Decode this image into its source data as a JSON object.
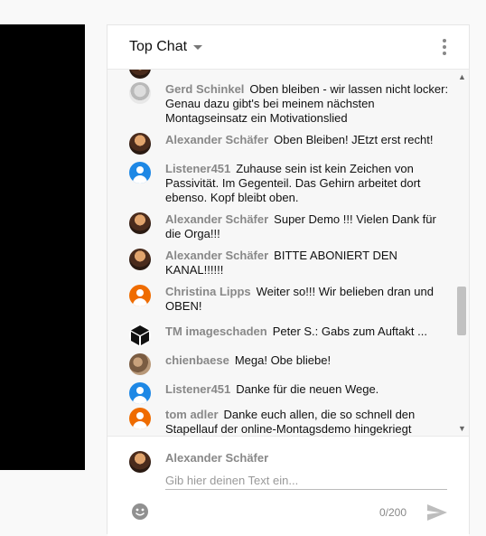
{
  "chat": {
    "title": "Top Chat",
    "messages": [
      {
        "author": "Gerd Schinkel",
        "text": "Oben bleiben - wir lassen nicht locker: Genau dazu gibt's bei meinem nächsten Montagseinsatz ein Motivationslied"
      },
      {
        "author": "Alexander Schäfer",
        "text": "Oben Bleiben! JEtzt erst recht!"
      },
      {
        "author": "Listener451",
        "text": "Zuhause sein ist kein Zeichen von Passivität. Im Gegenteil. Das Gehirn arbeitet dort ebenso. Kopf bleibt oben."
      },
      {
        "author": "Alexander Schäfer",
        "text": "Super Demo !!! Vielen Dank für die Orga!!!"
      },
      {
        "author": "Alexander Schäfer",
        "text": "BITTE ABONIERT DEN KANAL!!!!!!"
      },
      {
        "author": "Christina Lipps",
        "text": "Weiter so!!! Wir belieben dran und OBEN!"
      },
      {
        "author": "TM imageschaden",
        "text": "Peter S.: Gabs zum Auftakt ..."
      },
      {
        "author": "chienbaese",
        "text": "Mega! Obe bliebe!"
      },
      {
        "author": "Listener451",
        "text": "Danke für die neuen Wege."
      },
      {
        "author": "tom adler",
        "text": "Danke euch allen, die so schnell den Stapellauf der online-Montagsdemo hingekriegt"
      }
    ],
    "input": {
      "user": "Alexander Schäfer",
      "placeholder": "Gib hier deinen Text ein...",
      "counter": "0/200"
    }
  },
  "icons": {
    "more": "more-vert-icon",
    "caret": "caret-down-icon",
    "jump": "arrow-down-icon",
    "emoji": "emoji-icon",
    "send": "send-icon"
  },
  "colors": {
    "accent": "#2196f3",
    "author": "#888888",
    "avatar_blue": "#1e88e5",
    "avatar_orange": "#ef6c00"
  }
}
